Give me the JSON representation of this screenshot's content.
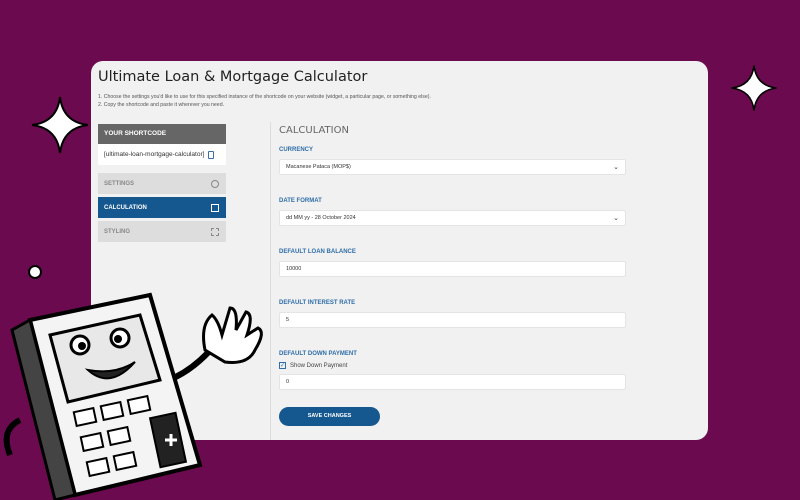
{
  "app": {
    "title": "Ultimate Loan & Mortgage Calculator",
    "instructions": [
      "1. Choose the settings you'd like to use for this specified instance of the shortcode on your website (widget, a particular page, or something else).",
      "2. Copy the shortcode and paste it wherever you need."
    ]
  },
  "sidebar": {
    "shortcode_header": "YOUR SHORTCODE",
    "shortcode_value": "[ultimate-loan-mortgage-calculator]",
    "items": [
      {
        "label": "SETTINGS",
        "icon": "gear-icon"
      },
      {
        "label": "CALCULATION",
        "icon": "calculator-icon",
        "active": true
      },
      {
        "label": "STYLING",
        "icon": "grid-icon"
      }
    ]
  },
  "main": {
    "section_title": "CALCULATION",
    "currency": {
      "label": "CURRENCY",
      "value": "Macanese Pataca (MOP$)"
    },
    "date_format": {
      "label": "DATE FORMAT",
      "value": "dd MM yy - 28 October 2024"
    },
    "loan_balance": {
      "label": "DEFAULT LOAN BALANCE",
      "value": "10000"
    },
    "interest_rate": {
      "label": "DEFAULT INTEREST RATE",
      "value": "5"
    },
    "down_payment": {
      "label": "DEFAULT DOWN PAYMENT",
      "checkbox_label": "Show Down Payment",
      "checked": true,
      "value": "0"
    },
    "save_label": "SAVE CHANGES"
  },
  "colors": {
    "background": "#6b0a4e",
    "accent": "#15578f",
    "label": "#2e6da8"
  }
}
